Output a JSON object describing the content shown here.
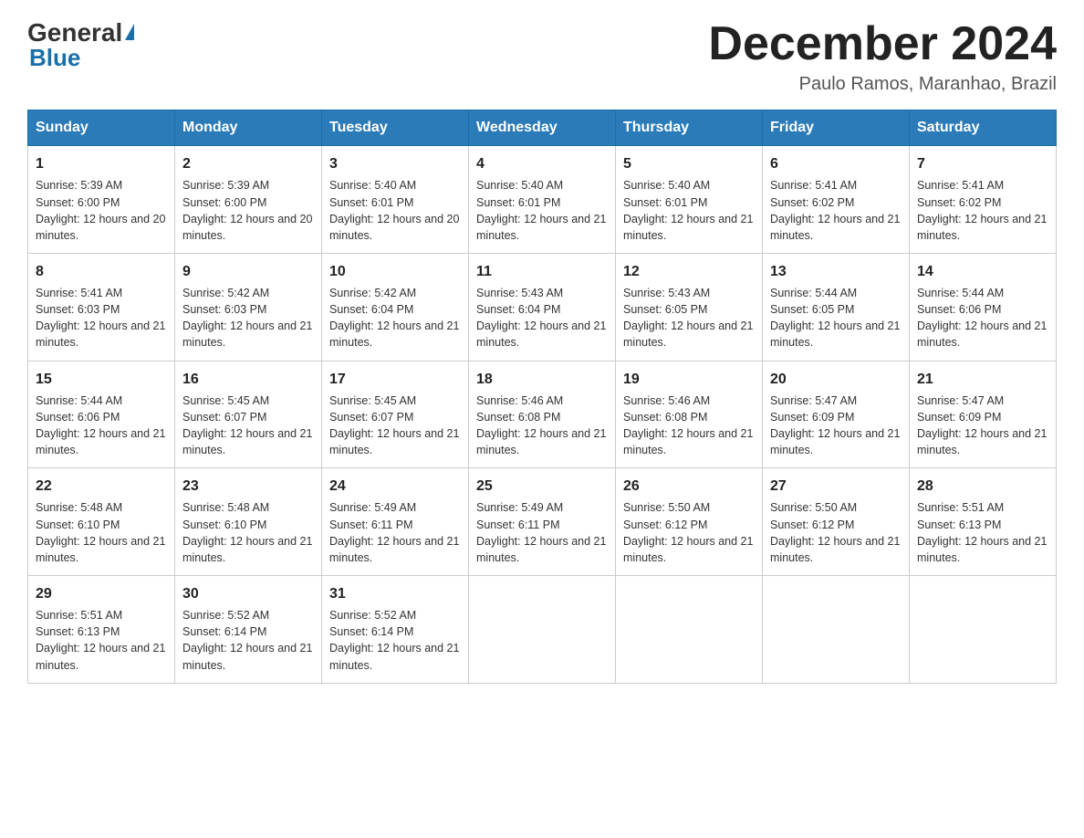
{
  "header": {
    "logo_line1": "General",
    "logo_line2": "Blue",
    "month_title": "December 2024",
    "location": "Paulo Ramos, Maranhao, Brazil"
  },
  "days_of_week": [
    "Sunday",
    "Monday",
    "Tuesday",
    "Wednesday",
    "Thursday",
    "Friday",
    "Saturday"
  ],
  "weeks": [
    [
      {
        "day": "1",
        "sunrise": "Sunrise: 5:39 AM",
        "sunset": "Sunset: 6:00 PM",
        "daylight": "Daylight: 12 hours and 20 minutes."
      },
      {
        "day": "2",
        "sunrise": "Sunrise: 5:39 AM",
        "sunset": "Sunset: 6:00 PM",
        "daylight": "Daylight: 12 hours and 20 minutes."
      },
      {
        "day": "3",
        "sunrise": "Sunrise: 5:40 AM",
        "sunset": "Sunset: 6:01 PM",
        "daylight": "Daylight: 12 hours and 20 minutes."
      },
      {
        "day": "4",
        "sunrise": "Sunrise: 5:40 AM",
        "sunset": "Sunset: 6:01 PM",
        "daylight": "Daylight: 12 hours and 21 minutes."
      },
      {
        "day": "5",
        "sunrise": "Sunrise: 5:40 AM",
        "sunset": "Sunset: 6:01 PM",
        "daylight": "Daylight: 12 hours and 21 minutes."
      },
      {
        "day": "6",
        "sunrise": "Sunrise: 5:41 AM",
        "sunset": "Sunset: 6:02 PM",
        "daylight": "Daylight: 12 hours and 21 minutes."
      },
      {
        "day": "7",
        "sunrise": "Sunrise: 5:41 AM",
        "sunset": "Sunset: 6:02 PM",
        "daylight": "Daylight: 12 hours and 21 minutes."
      }
    ],
    [
      {
        "day": "8",
        "sunrise": "Sunrise: 5:41 AM",
        "sunset": "Sunset: 6:03 PM",
        "daylight": "Daylight: 12 hours and 21 minutes."
      },
      {
        "day": "9",
        "sunrise": "Sunrise: 5:42 AM",
        "sunset": "Sunset: 6:03 PM",
        "daylight": "Daylight: 12 hours and 21 minutes."
      },
      {
        "day": "10",
        "sunrise": "Sunrise: 5:42 AM",
        "sunset": "Sunset: 6:04 PM",
        "daylight": "Daylight: 12 hours and 21 minutes."
      },
      {
        "day": "11",
        "sunrise": "Sunrise: 5:43 AM",
        "sunset": "Sunset: 6:04 PM",
        "daylight": "Daylight: 12 hours and 21 minutes."
      },
      {
        "day": "12",
        "sunrise": "Sunrise: 5:43 AM",
        "sunset": "Sunset: 6:05 PM",
        "daylight": "Daylight: 12 hours and 21 minutes."
      },
      {
        "day": "13",
        "sunrise": "Sunrise: 5:44 AM",
        "sunset": "Sunset: 6:05 PM",
        "daylight": "Daylight: 12 hours and 21 minutes."
      },
      {
        "day": "14",
        "sunrise": "Sunrise: 5:44 AM",
        "sunset": "Sunset: 6:06 PM",
        "daylight": "Daylight: 12 hours and 21 minutes."
      }
    ],
    [
      {
        "day": "15",
        "sunrise": "Sunrise: 5:44 AM",
        "sunset": "Sunset: 6:06 PM",
        "daylight": "Daylight: 12 hours and 21 minutes."
      },
      {
        "day": "16",
        "sunrise": "Sunrise: 5:45 AM",
        "sunset": "Sunset: 6:07 PM",
        "daylight": "Daylight: 12 hours and 21 minutes."
      },
      {
        "day": "17",
        "sunrise": "Sunrise: 5:45 AM",
        "sunset": "Sunset: 6:07 PM",
        "daylight": "Daylight: 12 hours and 21 minutes."
      },
      {
        "day": "18",
        "sunrise": "Sunrise: 5:46 AM",
        "sunset": "Sunset: 6:08 PM",
        "daylight": "Daylight: 12 hours and 21 minutes."
      },
      {
        "day": "19",
        "sunrise": "Sunrise: 5:46 AM",
        "sunset": "Sunset: 6:08 PM",
        "daylight": "Daylight: 12 hours and 21 minutes."
      },
      {
        "day": "20",
        "sunrise": "Sunrise: 5:47 AM",
        "sunset": "Sunset: 6:09 PM",
        "daylight": "Daylight: 12 hours and 21 minutes."
      },
      {
        "day": "21",
        "sunrise": "Sunrise: 5:47 AM",
        "sunset": "Sunset: 6:09 PM",
        "daylight": "Daylight: 12 hours and 21 minutes."
      }
    ],
    [
      {
        "day": "22",
        "sunrise": "Sunrise: 5:48 AM",
        "sunset": "Sunset: 6:10 PM",
        "daylight": "Daylight: 12 hours and 21 minutes."
      },
      {
        "day": "23",
        "sunrise": "Sunrise: 5:48 AM",
        "sunset": "Sunset: 6:10 PM",
        "daylight": "Daylight: 12 hours and 21 minutes."
      },
      {
        "day": "24",
        "sunrise": "Sunrise: 5:49 AM",
        "sunset": "Sunset: 6:11 PM",
        "daylight": "Daylight: 12 hours and 21 minutes."
      },
      {
        "day": "25",
        "sunrise": "Sunrise: 5:49 AM",
        "sunset": "Sunset: 6:11 PM",
        "daylight": "Daylight: 12 hours and 21 minutes."
      },
      {
        "day": "26",
        "sunrise": "Sunrise: 5:50 AM",
        "sunset": "Sunset: 6:12 PM",
        "daylight": "Daylight: 12 hours and 21 minutes."
      },
      {
        "day": "27",
        "sunrise": "Sunrise: 5:50 AM",
        "sunset": "Sunset: 6:12 PM",
        "daylight": "Daylight: 12 hours and 21 minutes."
      },
      {
        "day": "28",
        "sunrise": "Sunrise: 5:51 AM",
        "sunset": "Sunset: 6:13 PM",
        "daylight": "Daylight: 12 hours and 21 minutes."
      }
    ],
    [
      {
        "day": "29",
        "sunrise": "Sunrise: 5:51 AM",
        "sunset": "Sunset: 6:13 PM",
        "daylight": "Daylight: 12 hours and 21 minutes."
      },
      {
        "day": "30",
        "sunrise": "Sunrise: 5:52 AM",
        "sunset": "Sunset: 6:14 PM",
        "daylight": "Daylight: 12 hours and 21 minutes."
      },
      {
        "day": "31",
        "sunrise": "Sunrise: 5:52 AM",
        "sunset": "Sunset: 6:14 PM",
        "daylight": "Daylight: 12 hours and 21 minutes."
      },
      null,
      null,
      null,
      null
    ]
  ]
}
